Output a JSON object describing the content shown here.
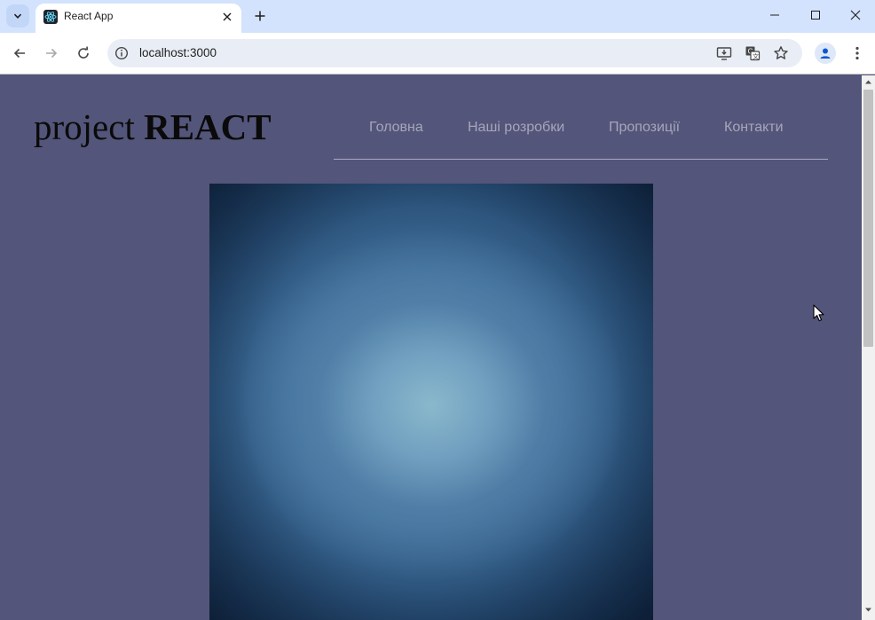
{
  "browser": {
    "tab_title": "React App",
    "url": "localhost:3000"
  },
  "page": {
    "logo_light": "project ",
    "logo_bold": "REACT",
    "nav": [
      {
        "label": "Головна"
      },
      {
        "label": "Наші розробки"
      },
      {
        "label": "Пропозиції"
      },
      {
        "label": "Контакти"
      }
    ]
  },
  "icons": {
    "favicon": "react-logo-icon",
    "site": "info-icon"
  },
  "colors": {
    "page_background": "#54557a",
    "nav_text": "#a6a6ba",
    "logo_text": "#0a0a0a",
    "tabbar": "#d3e3fd"
  }
}
